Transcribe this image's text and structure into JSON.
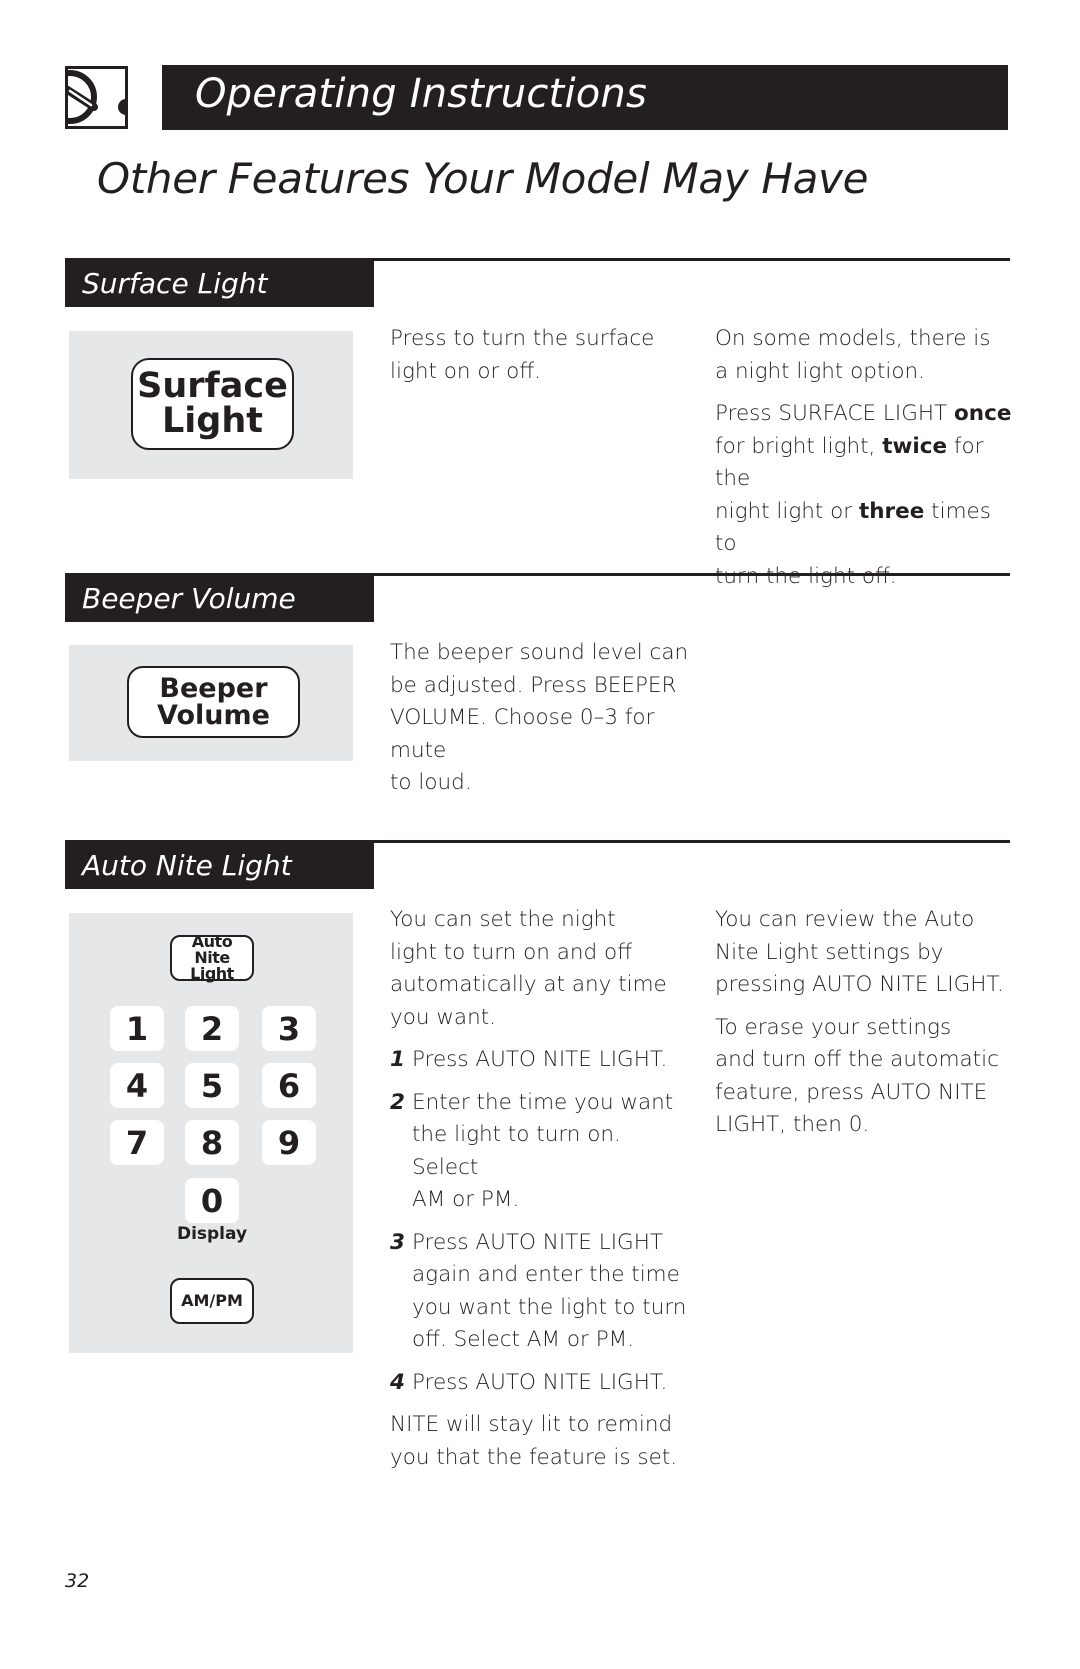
{
  "header": {
    "logo_icon": "ge-range-knob-icon",
    "title": "Operating Instructions"
  },
  "page_subtitle": "Other Features Your Model May Have",
  "sections": {
    "surface_light": {
      "title": "Surface Light",
      "key_label_line1": "Surface",
      "key_label_line2": "Light",
      "col1": [
        "Press to turn the surface",
        "light on or off."
      ],
      "col2_p1": [
        "On some models, there is",
        "a night light option."
      ],
      "col2_p2": {
        "pre": "Press SURFACE LIGHT ",
        "once": "once",
        "mid1": "for bright light, ",
        "twice": "twice",
        "mid2": " for the",
        "mid3": "night light or ",
        "three": "three",
        "mid4": " times to",
        "end": "turn the light off."
      }
    },
    "beeper_volume": {
      "title": "Beeper Volume",
      "key_label_line1": "Beeper",
      "key_label_line2": "Volume",
      "col1": [
        "The beeper sound level can",
        "be adjusted. Press BEEPER",
        "VOLUME. Choose 0–3 for",
        "mute",
        "to loud."
      ]
    },
    "auto_nite_light": {
      "title": "Auto Nite Light",
      "key_label_line1": "Auto Nite",
      "key_label_line2": "Light",
      "keypad": [
        "1",
        "2",
        "3",
        "4",
        "5",
        "6",
        "7",
        "8",
        "9",
        "0"
      ],
      "display_label": "Display",
      "ampm_label": "AM/PM",
      "intro": [
        "You can set the night",
        "light to turn on and off",
        "automatically at any time",
        "you want."
      ],
      "steps": [
        {
          "num": "1",
          "lines": [
            "Press AUTO NITE LIGHT."
          ]
        },
        {
          "num": "2",
          "lines": [
            "Enter the time you want",
            "the light to turn on. Select",
            "AM or PM."
          ]
        },
        {
          "num": "3",
          "lines": [
            "Press AUTO NITE LIGHT",
            "again and enter the time",
            "you want the light to turn",
            "off. Select AM or PM."
          ]
        },
        {
          "num": "4",
          "lines": [
            "Press AUTO NITE LIGHT."
          ]
        }
      ],
      "outro": [
        "NITE will stay lit to remind",
        "you that the feature is set."
      ],
      "col2_p1": [
        "You can review the Auto",
        "Nite Light settings by",
        "pressing AUTO NITE LIGHT."
      ],
      "col2_p2": [
        "To erase your settings",
        "and turn off the automatic",
        "feature, press AUTO NITE",
        "LIGHT, then 0."
      ]
    }
  },
  "page_number": "32"
}
